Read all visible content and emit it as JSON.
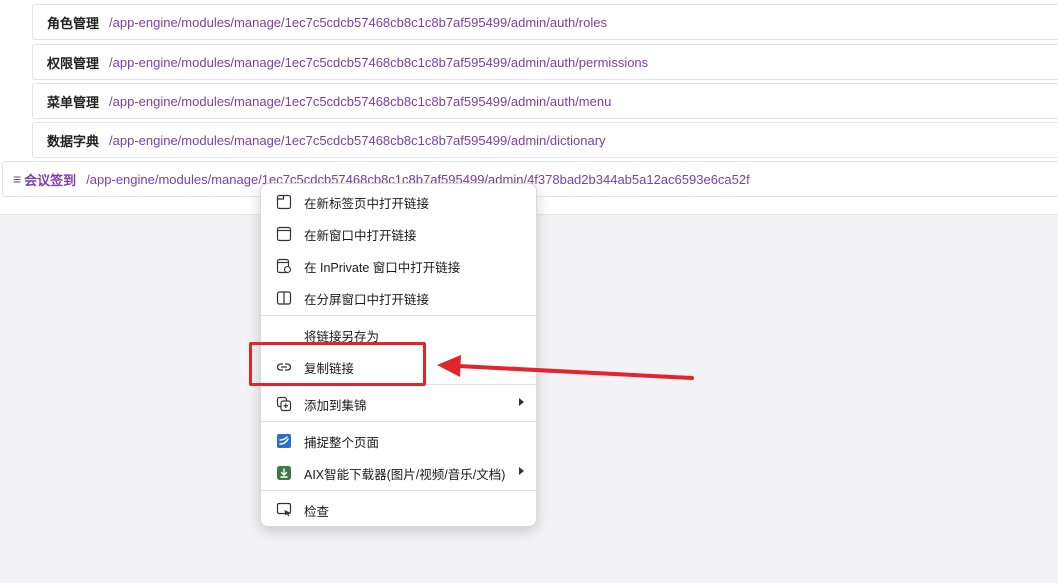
{
  "nav_rows": [
    {
      "name": "角色管理",
      "path": "/app-engine/modules/manage/1ec7c5cdcb57468cb8c1c8b7af595499/admin/auth/roles"
    },
    {
      "name": "权限管理",
      "path": "/app-engine/modules/manage/1ec7c5cdcb57468cb8c1c8b7af595499/admin/auth/permissions"
    },
    {
      "name": "菜单管理",
      "path": "/app-engine/modules/manage/1ec7c5cdcb57468cb8c1c8b7af595499/admin/auth/menu"
    },
    {
      "name": "数据字典",
      "path": "/app-engine/modules/manage/1ec7c5cdcb57468cb8c1c8b7af595499/admin/dictionary"
    }
  ],
  "top_row": {
    "icon": "≡",
    "name": "会议签到",
    "path": "/app-engine/modules/manage/1ec7c5cdcb57468cb8c1c8b7af595499/admin/4f378bad2b344ab5a12ac6593e6ca52f"
  },
  "context_menu": {
    "items": [
      {
        "label": "在新标签页中打开链接",
        "icon": "new-tab-icon"
      },
      {
        "label": "在新窗口中打开链接",
        "icon": "new-window-icon"
      },
      {
        "label": "在 InPrivate 窗口中打开链接",
        "icon": "inprivate-window-icon"
      },
      {
        "label": "在分屏窗口中打开链接",
        "icon": "split-screen-icon"
      },
      {
        "label": "将链接另存为",
        "icon": ""
      },
      {
        "label": "复制链接",
        "icon": "link-icon"
      },
      {
        "label": "添加到集锦",
        "icon": "collections-icon",
        "has_submenu": true
      },
      {
        "label": "捕捉整个页面",
        "icon": "screenshot-app-icon"
      },
      {
        "label": "AIX智能下载器(图片/视频/音乐/文档)",
        "icon": "download-extension-icon",
        "has_submenu": true
      },
      {
        "label": "检查",
        "icon": "inspect-icon"
      }
    ]
  },
  "colors": {
    "link_purple": "#7b3fa8",
    "highlight_red": "#e0262b",
    "page_bg": "#f3f3f6"
  }
}
